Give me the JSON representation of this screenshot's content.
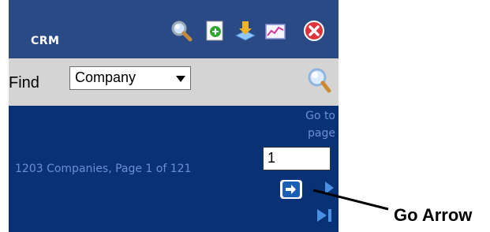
{
  "header": {
    "title": "CRM",
    "toolbar_icons": [
      "search-icon",
      "add-icon",
      "download-icon",
      "chart-icon",
      "close-icon"
    ]
  },
  "find": {
    "label": "Find",
    "selected_option": "Company"
  },
  "pagination": {
    "goto_label": "Go to page",
    "status": "1203 Companies, Page 1 of 121",
    "page_value": "1"
  },
  "annotation": {
    "label": "Go Arrow"
  },
  "colors": {
    "panel_background": "#093176",
    "header_background": "#2a4a85",
    "find_bar_background": "#d4d4d4",
    "link_text": "#6d8fd0"
  }
}
